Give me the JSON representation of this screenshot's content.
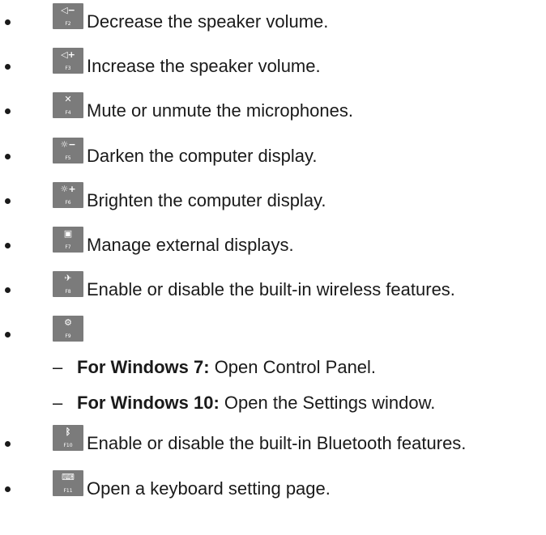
{
  "items": [
    {
      "key_label": "F2",
      "icon": "speaker-decrease-icon",
      "glyph": "◁−",
      "text": "Decrease the speaker volume."
    },
    {
      "key_label": "F3",
      "icon": "speaker-increase-icon",
      "glyph": "◁+",
      "text": "Increase the speaker volume."
    },
    {
      "key_label": "F4",
      "icon": "microphone-mute-icon",
      "glyph": "✕",
      "text": "Mute or unmute the microphones."
    },
    {
      "key_label": "F5",
      "icon": "brightness-decrease-icon",
      "glyph": "☼−",
      "text": "Darken the computer display."
    },
    {
      "key_label": "F6",
      "icon": "brightness-increase-icon",
      "glyph": "☼+",
      "text": "Brighten the computer display."
    },
    {
      "key_label": "F7",
      "icon": "external-display-icon",
      "glyph": "▣",
      "text": "Manage external displays."
    },
    {
      "key_label": "F8",
      "icon": "wireless-off-icon",
      "glyph": "✈",
      "text": "Enable or disable the built-in wireless features."
    },
    {
      "key_label": "F9",
      "icon": "settings-gear-icon",
      "glyph": "⚙",
      "text": ""
    },
    {
      "key_label": "F10",
      "icon": "bluetooth-icon",
      "glyph": "ᛒ",
      "text": "Enable or disable the built-in Bluetooth features."
    },
    {
      "key_label": "F11",
      "icon": "keyboard-icon",
      "glyph": "⌨",
      "text": "Open a keyboard setting page."
    }
  ],
  "f9_sub": [
    {
      "dash": "–",
      "label": "For Windows 7:",
      "text": " Open Control Panel."
    },
    {
      "dash": "–",
      "label": "For Windows 10:",
      "text": " Open the Settings window."
    }
  ],
  "colors": {
    "key_background": "#7b7b7b",
    "text": "#1a1a1a"
  }
}
